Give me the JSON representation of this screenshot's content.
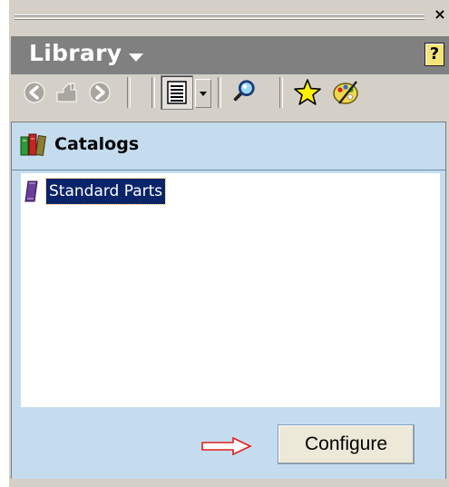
{
  "panel": {
    "title": "Library",
    "close_glyph": "×",
    "help_glyph": "?"
  },
  "toolbar": {
    "icons": [
      "back-arrow-icon",
      "home-icon",
      "forward-arrow-icon",
      "list-view-icon",
      "dropdown-arrow-icon",
      "search-icon",
      "favorites-star-icon",
      "palette-icon"
    ]
  },
  "catalogs": {
    "title": "Catalogs",
    "items": [
      {
        "label": "Standard Parts",
        "selected": true
      }
    ]
  },
  "footer": {
    "configure_label": "Configure"
  },
  "colors": {
    "titlebar": "#808080",
    "panel_bg": "#d4d0c8",
    "content_bg": "#c5dcef",
    "selection": "#0a246a",
    "pointer_arrow": "#e0201a"
  }
}
